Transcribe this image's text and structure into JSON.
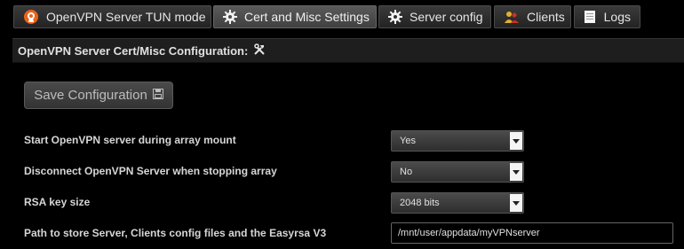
{
  "tabs": [
    {
      "label": "OpenVPN Server TUN mode",
      "icon": "openvpn-logo-icon"
    },
    {
      "label": "Cert and Misc Settings",
      "icon": "gear-icon",
      "active": true
    },
    {
      "label": "Server config",
      "icon": "gear-icon"
    },
    {
      "label": "Clients",
      "icon": "users-icon"
    },
    {
      "label": "Logs",
      "icon": "document-icon"
    }
  ],
  "section": {
    "title": "OpenVPN Server Cert/Misc Configuration:",
    "icon": "tools-icon"
  },
  "save_button": {
    "label": "Save Configuration",
    "icon": "floppy-disk-icon"
  },
  "settings": [
    {
      "label": "Start OpenVPN server during array mount",
      "value": "Yes"
    },
    {
      "label": "Disconnect OpenVPN Server when stopping array",
      "value": "No"
    },
    {
      "label": "RSA key size",
      "value": "2048 bits"
    },
    {
      "label": "Path to store Server, Clients config files and the Easyrsa V3",
      "value": "/mnt/user/appdata/myVPNserver"
    }
  ],
  "colors": {
    "accent_orange": "#e8641b",
    "background": "#000000"
  }
}
